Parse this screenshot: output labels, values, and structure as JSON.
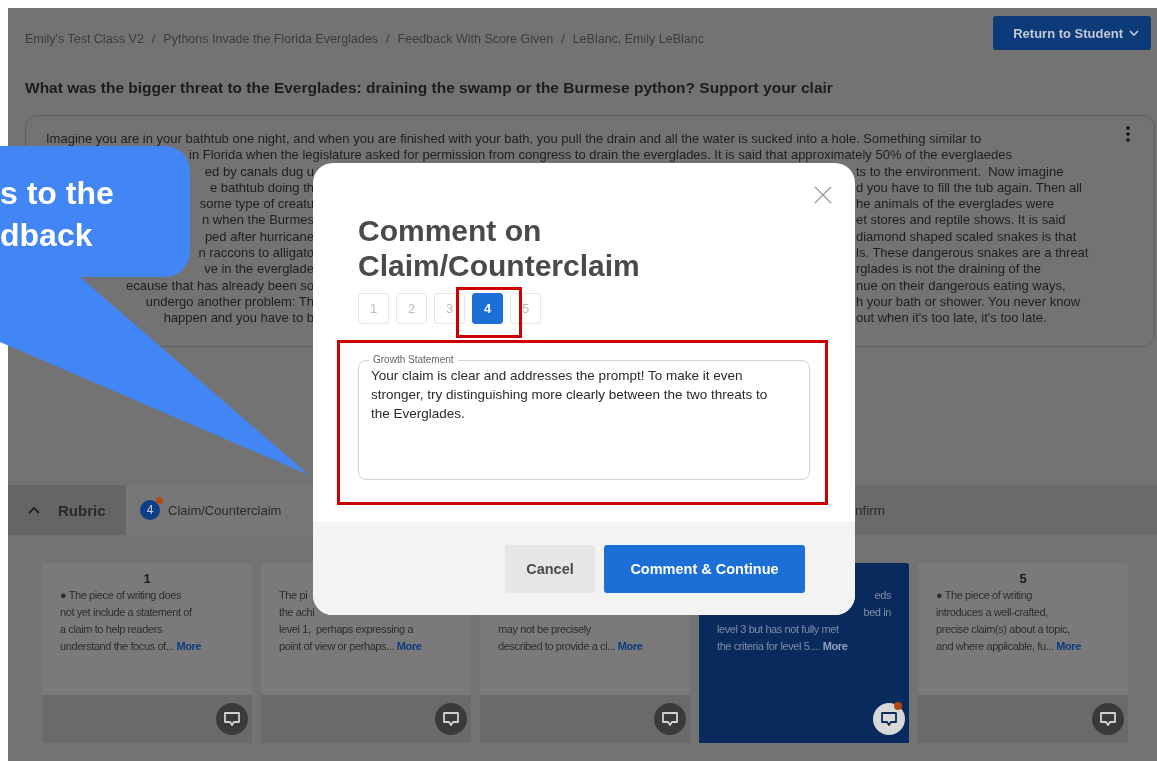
{
  "breadcrumb": [
    {
      "label": "Emily's Test Class V2"
    },
    {
      "label": "Pythons Invade the Florida Everglades"
    },
    {
      "label": "Feedback With Score Given"
    },
    {
      "label": "LeBlanc, Emily LeBlanc"
    }
  ],
  "separators": [
    "/",
    "/",
    "/"
  ],
  "return_button": "Return to Student",
  "question": "What was the bigger threat to the Everglades: draining the swamp or the Burmese python? Support your clair",
  "essay_lines": [
    {
      "kind": "full",
      "text": "Imagine you are in your bathtub one night, and when you are finished with your bath, you pull the drain and all the water is sucked into a hole. Something similar to"
    },
    {
      "kind": "tail",
      "text": "in Florida when the legislature asked for permission from congress to drain the everglades. It is said that approximately 50% of the everglaedes"
    },
    {
      "kind": "split",
      "left": "ed by canals dug u",
      "right": "ts to the environment.  Now imagine"
    },
    {
      "kind": "split",
      "left": "e bathtub doing th",
      "right": "d you have to fill the tub again. Then all"
    },
    {
      "kind": "split",
      "left": "some type of creatu",
      "right": "he animals of the everglades were"
    },
    {
      "kind": "split",
      "left": "n when the Burmes",
      "right": "et stores and reptile shows. It is said"
    },
    {
      "kind": "split",
      "left": "ped after hurricane",
      "right": "diamond shaped scaled snakes is that"
    },
    {
      "kind": "split",
      "left": "n raccons to alligato",
      "right": "ls. These dangerous snakes are a threat"
    },
    {
      "kind": "split",
      "left": "ve in the everglade",
      "right": "rglades is not the draining of the"
    },
    {
      "kind": "split",
      "left": "ecause that has already been so",
      "right": "nue on their dangerous eating ways,"
    },
    {
      "kind": "split",
      "left": "undergo another problem: Th",
      "right": "h your bath or shower. You never know"
    },
    {
      "kind": "split",
      "left": "happen and you have to b",
      "right": "out when it's too late, it's too late."
    }
  ],
  "callout": {
    "lines": [
      "s to the",
      "dback"
    ]
  },
  "rubric_tabs": [
    {
      "kind": "toggle",
      "label": "Rubric",
      "selected": false
    },
    {
      "kind": "criterion",
      "label": "Claim/Counterclaim",
      "badge": "4",
      "selected": true
    },
    {
      "kind": "criterion",
      "label": "nfirm",
      "selected": false
    }
  ],
  "rubric_cards": [
    {
      "number": "1",
      "selected": false,
      "has_comment": false,
      "lines": [
        {
          "text": "● The piece of writing does"
        },
        {
          "text": "not yet include a statement of"
        },
        {
          "text": "a claim to help readers"
        },
        {
          "text": "understand the focus of..."
        }
      ],
      "more": "More"
    },
    {
      "selected": false,
      "has_comment": false,
      "lines": [
        {
          "text": "The pi"
        },
        {
          "text": "the achi"
        },
        {
          "text": "level 1,  perhaps expressing a"
        },
        {
          "text": "point of view or perhaps..."
        }
      ],
      "more": "More"
    },
    {
      "selected": false,
      "has_comment": false,
      "lines": [
        {
          "text": "may not be precisely"
        },
        {
          "text": "described to provide a cl..."
        }
      ],
      "more": "More"
    },
    {
      "selected": true,
      "has_comment": true,
      "lines": [
        {
          "text": "eds",
          "kind": "tail"
        },
        {
          "text": "bed in",
          "kind": "tail"
        },
        {
          "text": "level 3 but has not fully met"
        },
        {
          "text": "the criteria for level 5...."
        }
      ],
      "more": "More"
    },
    {
      "number": "5",
      "selected": false,
      "has_comment": false,
      "lines": [
        {
          "text": "● The piece of writing"
        },
        {
          "text": "introduces a well-crafted,"
        },
        {
          "text": "precise claim(s) about a topic,"
        },
        {
          "text": "and where applicable, fu..."
        }
      ],
      "more": "More"
    }
  ],
  "modal": {
    "title": "Comment on Claim/Counterclaim",
    "steps": [
      {
        "label": "1",
        "selected": false
      },
      {
        "label": "2",
        "selected": false
      },
      {
        "label": "3",
        "selected": false
      },
      {
        "label": "4",
        "selected": true
      },
      {
        "label": "5",
        "selected": false
      }
    ],
    "field": {
      "label": "Growth Statement",
      "value": "Your claim is clear and addresses the prompt! To make it even stronger, try distinguishing more clearly between the two threats to the Everglades."
    },
    "cancel": "Cancel",
    "submit": "Comment & Continue"
  }
}
